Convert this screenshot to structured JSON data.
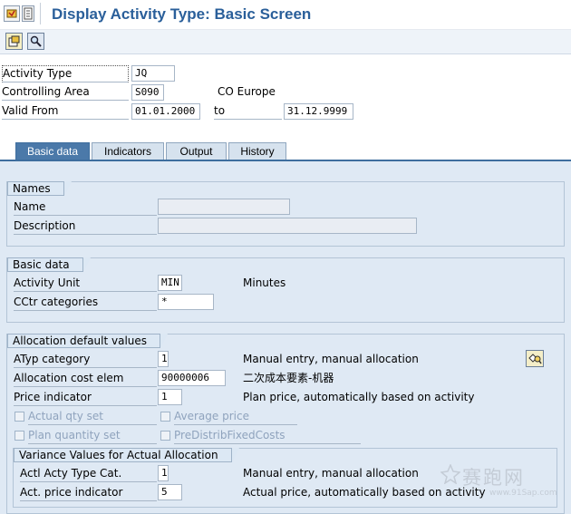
{
  "window": {
    "title": "Display Activity Type: Basic Screen"
  },
  "header": {
    "activity_type_label": "Activity Type",
    "activity_type_value": "JQ",
    "controlling_area_label": "Controlling Area",
    "controlling_area_value": "S090",
    "controlling_area_text": "CO Europe",
    "valid_from_label": "Valid From",
    "valid_from_value": "01.01.2000",
    "to_label": "to",
    "valid_to_value": "31.12.9999"
  },
  "tabs": [
    {
      "label": "Basic data",
      "active": true
    },
    {
      "label": "Indicators",
      "active": false
    },
    {
      "label": "Output",
      "active": false
    },
    {
      "label": "History",
      "active": false
    }
  ],
  "names": {
    "title": "Names",
    "name_label": "Name",
    "name_value": "",
    "description_label": "Description",
    "description_value": ""
  },
  "basic": {
    "title": "Basic data",
    "unit_label": "Activity Unit",
    "unit_value": "MIN",
    "unit_text": "Minutes",
    "cctr_label": "CCtr categories",
    "cctr_value": "*"
  },
  "alloc": {
    "title": "Allocation default values",
    "atyp_label": "ATyp category",
    "atyp_value": "1",
    "atyp_text": "Manual entry, manual allocation",
    "cost_elem_label": "Allocation cost elem",
    "cost_elem_value": "90000006",
    "cost_elem_text": "二次成本要素-机器",
    "price_ind_label": "Price indicator",
    "price_ind_value": "1",
    "price_ind_text": "Plan price, automatically based on activity",
    "actual_qty_label": "Actual qty set",
    "average_price_label": "Average price",
    "plan_qty_label": "Plan quantity set",
    "predistrib_label": "PreDistribFixedCosts"
  },
  "variance": {
    "title": "Variance Values for Actual Allocation",
    "actl_type_label": "Actl Acty Type Cat.",
    "actl_type_value": "1",
    "actl_type_text": "Manual entry, manual allocation",
    "act_price_label": "Act. price indicator",
    "act_price_value": "5",
    "act_price_text": "Actual price, automatically based on activity"
  },
  "watermark": {
    "chars": "赛跑网",
    "url": "www.91Sap.com"
  },
  "colors": {
    "title_blue": "#2a5f9a",
    "tab_active": "#4b79a9",
    "panel_bg": "#dfe9f4"
  }
}
